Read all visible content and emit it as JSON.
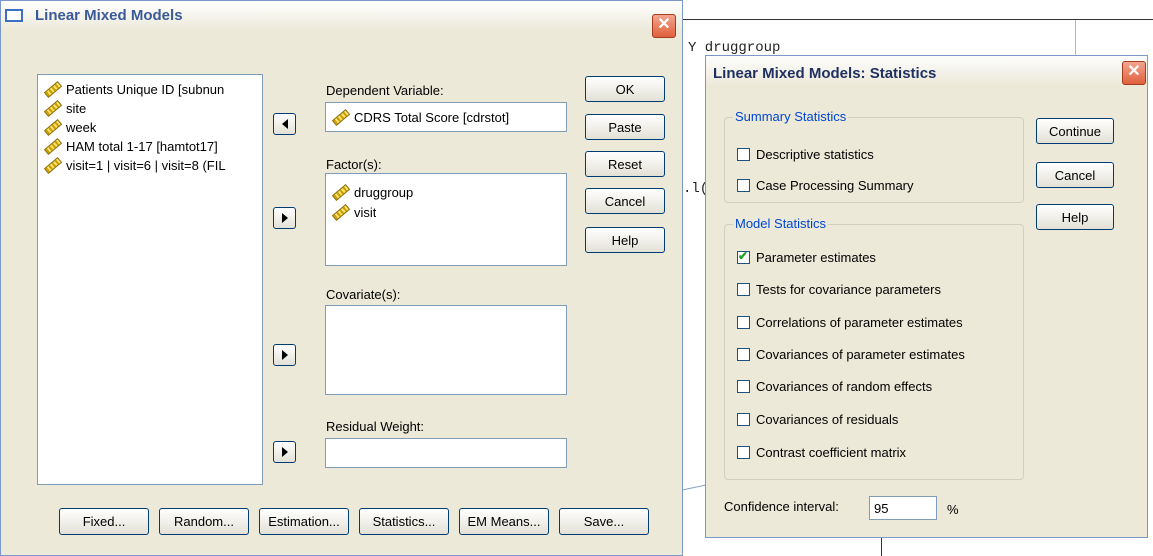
{
  "background": {
    "text_lines": [
      {
        "text": "Y druggroup"
      },
      {
        "text": ".l("
      }
    ]
  },
  "main_dialog": {
    "title": "Linear Mixed Models",
    "variables": [
      "Patients Unique ID [subnun",
      "site",
      "week",
      "HAM total 1-17 [hamtot17]",
      "visit=1 | visit=6 | visit=8 (FIL"
    ],
    "dependent_label": "Dependent Variable:",
    "dependent_value": "CDRS Total Score [cdrstot]",
    "factors_label": "Factor(s):",
    "factors": [
      "druggroup",
      "visit"
    ],
    "covariates_label": "Covariate(s):",
    "residual_label": "Residual Weight:",
    "buttons": {
      "ok": "OK",
      "paste": "Paste",
      "reset": "Reset",
      "cancel": "Cancel",
      "help": "Help"
    },
    "bottom_buttons": {
      "fixed": "Fixed...",
      "random": "Random...",
      "estimation": "Estimation...",
      "statistics": "Statistics...",
      "em_means": "EM Means...",
      "save": "Save..."
    }
  },
  "stats_dialog": {
    "title": "Linear Mixed Models: Statistics",
    "summary_legend": "Summary Statistics",
    "summary_items": [
      {
        "label": "Descriptive statistics",
        "checked": false
      },
      {
        "label": "Case Processing Summary",
        "checked": false
      }
    ],
    "model_legend": "Model Statistics",
    "model_items": [
      {
        "label": "Parameter estimates",
        "checked": true
      },
      {
        "label": "Tests for covariance parameters",
        "checked": false
      },
      {
        "label": "Correlations of parameter estimates",
        "checked": false
      },
      {
        "label": "Covariances of parameter estimates",
        "checked": false
      },
      {
        "label": "Covariances of random effects",
        "checked": false
      },
      {
        "label": "Covariances of residuals",
        "checked": false
      },
      {
        "label": "Contrast coefficient matrix",
        "checked": false
      }
    ],
    "buttons": {
      "continue": "Continue",
      "cancel": "Cancel",
      "help": "Help"
    },
    "ci_label": "Confidence interval:",
    "ci_value": "95",
    "ci_unit": "%"
  }
}
